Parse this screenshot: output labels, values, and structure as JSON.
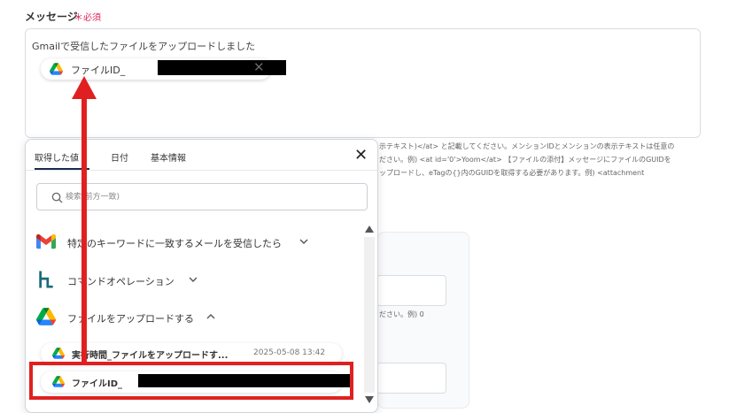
{
  "field": {
    "label": "メッセージ",
    "required_star": "＊",
    "required_text": "必須"
  },
  "message": {
    "text": "Gmailで受信したファイルをアップロードしました",
    "chip_label": "ファイルID_",
    "chip_close": "✕"
  },
  "help": {
    "line1": "示テキスト)</at> と記載してください。メンションIDとメンションの表示テキストは任意の",
    "line2": "ださい。例) <at id='0'>Yoom</at> 【ファイルの添付】メッセージにファイルのGUIDを",
    "line3": "ップロードし、eTagの{}内のGUIDを取得する必要があります。例) <attachment"
  },
  "background": {
    "note": "ださい。例) 0"
  },
  "panel": {
    "tabs": [
      {
        "label": "取得した値"
      },
      {
        "label": "日付"
      },
      {
        "label": "基本情報"
      }
    ],
    "close": "✕",
    "search_placeholder": "検索(前方一致)",
    "groups": [
      {
        "label": "特定のキーワードに一致するメールを受信したら",
        "icon": "gmail-icon",
        "expanded": false
      },
      {
        "label": "コマンドオペレーション",
        "icon": "command-operation-icon",
        "expanded": false
      },
      {
        "label": "ファイルをアップロードする",
        "icon": "google-drive-icon",
        "expanded": true
      }
    ],
    "items": [
      {
        "label": "実行時間_ファイルをアップロードす...",
        "date": "2025-05-08 13:42"
      },
      {
        "label": "ファイルID_"
      }
    ]
  },
  "colors": {
    "highlight": "#e02020",
    "arrow": "#e02020",
    "required": "#e0245e",
    "tab_underline": "#1a2a4a"
  }
}
